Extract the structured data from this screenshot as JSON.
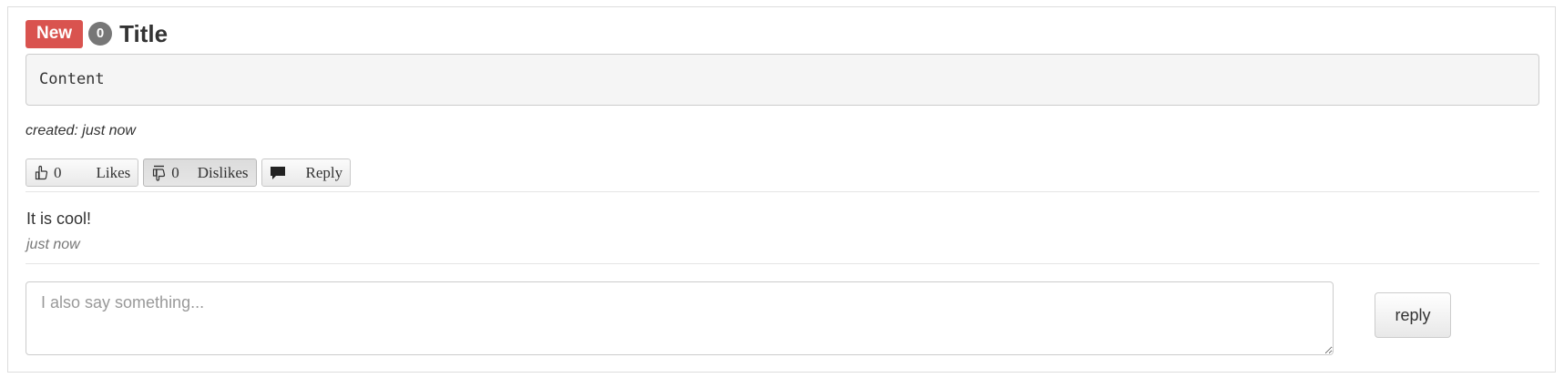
{
  "post": {
    "new_label": "New",
    "comment_count": "0",
    "title": "Title",
    "content": "Content",
    "created": "created: just now"
  },
  "actions": {
    "likes": {
      "count": "0",
      "label": "Likes",
      "icon": "thumbs-up-icon"
    },
    "dislikes": {
      "count": "0",
      "label": "Dislikes",
      "icon": "thumbs-down-icon"
    },
    "reply": {
      "label": "Reply",
      "icon": "speech-bubble-icon"
    }
  },
  "comments": [
    {
      "text": "It is cool!",
      "time": "just now"
    }
  ],
  "reply_form": {
    "placeholder": "I also say something...",
    "value": "",
    "submit_label": "reply"
  },
  "colors": {
    "new_label": "#d9534f",
    "badge": "#777777"
  }
}
